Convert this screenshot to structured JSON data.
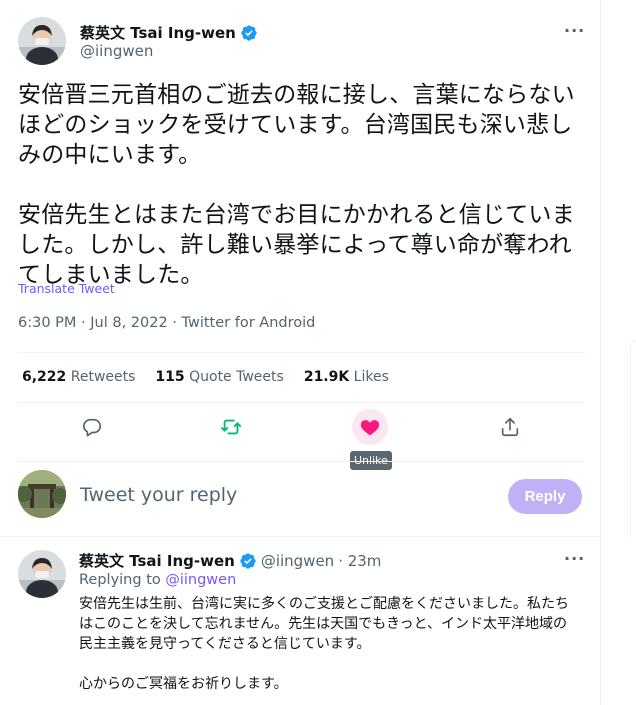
{
  "tweet": {
    "author_name": "蔡英文 Tsai Ing-wen",
    "author_handle": "@iingwen",
    "paragraphs": [
      "安倍晋三元首相のご逝去の報に接し、言葉にならないほどのショックを受けています。台湾国民も深い悲しみの中にいます。",
      "安倍先生とはまた台湾でお目にかかれると信じていました。しかし、許し難い暴挙によって尊い命が奪われてしまいました。"
    ],
    "translate_label": "Translate Tweet",
    "timestamp": "6:30 PM · Jul 8, 2022 · Twitter for Android",
    "stats": {
      "retweets_count": "6,222",
      "retweets_label": "Retweets",
      "quotes_count": "115",
      "quotes_label": "Quote Tweets",
      "likes_count": "21.9K",
      "likes_label": "Likes"
    },
    "actions": {
      "reply_icon": "comment-icon",
      "retweet_icon": "retweet-icon",
      "like_icon": "heart-filled-icon",
      "share_icon": "share-icon",
      "like_tooltip": "Unlike"
    }
  },
  "composer": {
    "placeholder": "Tweet your reply",
    "reply_button": "Reply"
  },
  "reply": {
    "author_name": "蔡英文 Tsai Ing-wen",
    "author_handle": "@iingwen",
    "time_ago": "· 23m",
    "replying_to_label": "Replying to",
    "replying_to_handle": "@iingwen",
    "paragraphs": [
      "安倍先生は生前、台湾に実に多くのご支援とご配慮をくださいました。私たちはこのことを決して忘れません。先生は天国でもきっと、インド太平洋地域の民主主義を見守ってくださると信じています。",
      "心からのご冥福をお祈りします。"
    ]
  },
  "colors": {
    "accent": "#7856ff",
    "verified": "#1d9bf0",
    "like": "#f91880",
    "retweet": "#00ba7c",
    "secondary_text": "#536471"
  }
}
